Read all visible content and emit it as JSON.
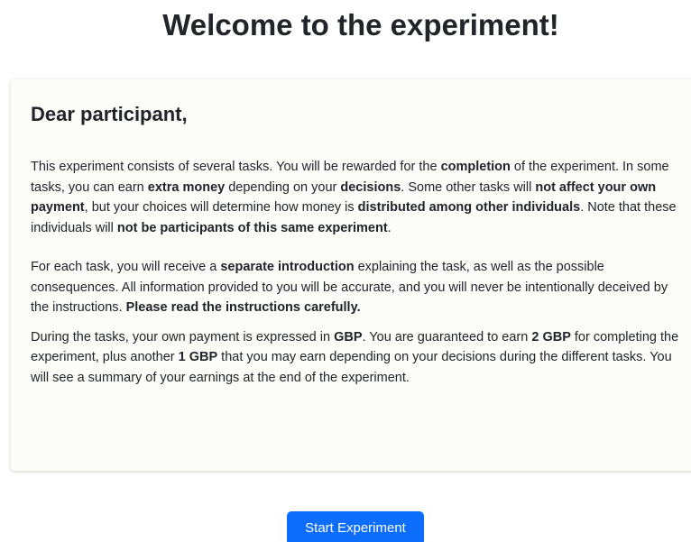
{
  "page": {
    "title": "Welcome to the experiment!"
  },
  "card": {
    "heading": "Dear participant,",
    "p1": {
      "t1": "This experiment consists of several tasks. You will be rewarded for the ",
      "b1": "completion",
      "t2": " of the experiment. In some tasks, you can earn ",
      "b2": "extra money",
      "t3": " depending on your ",
      "b3": "decisions",
      "t4": ". Some other tasks will ",
      "b4": "not affect your own payment",
      "t5": ", but your choices will determine how money is ",
      "b5": "distributed among other individuals",
      "t6": ". Note that these individuals will ",
      "b6": "not be participants of this same experiment",
      "t7": "."
    },
    "p2": {
      "t1": "For each task, you will receive a ",
      "b1": "separate introduction",
      "t2": " explaining the task, as well as the possible consequences. All information provided to you will be accurate, and you will never be intentionally deceived by the instructions. ",
      "b2": "Please read the instructions carefully."
    },
    "p3": {
      "t1": "During the tasks, your own payment is expressed in ",
      "b1": "GBP",
      "t2": ". You are guaranteed to earn ",
      "b2": "2 GBP",
      "t3": " for completing the experiment, plus another ",
      "b3": "1 GBP",
      "t4": " that you may earn depending on your decisions during the different tasks. You will see a summary of your earnings at the end of the experiment."
    }
  },
  "actions": {
    "start_label": "Start Experiment"
  },
  "colors": {
    "primary": "#0d6efd",
    "card_background": "#fcfcf9",
    "text": "#212529"
  }
}
